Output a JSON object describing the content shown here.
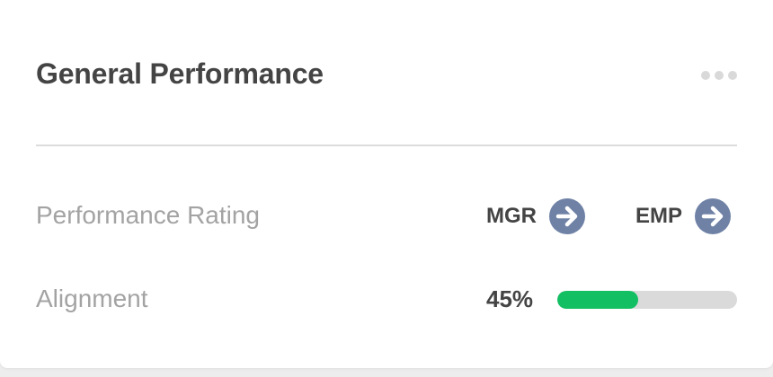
{
  "card": {
    "title": "General Performance",
    "menu_icon": "more-horizontal-icon"
  },
  "performance_rating": {
    "label": "Performance Rating",
    "mgr_label": "MGR",
    "emp_label": "EMP",
    "arrow_icon": "arrow-right-circle-icon",
    "arrow_color": "#6f82a6"
  },
  "alignment": {
    "label": "Alignment",
    "value_text": "45%",
    "value_fraction": 0.45,
    "bar_color": "#12bf63",
    "track_color": "#dadada"
  }
}
